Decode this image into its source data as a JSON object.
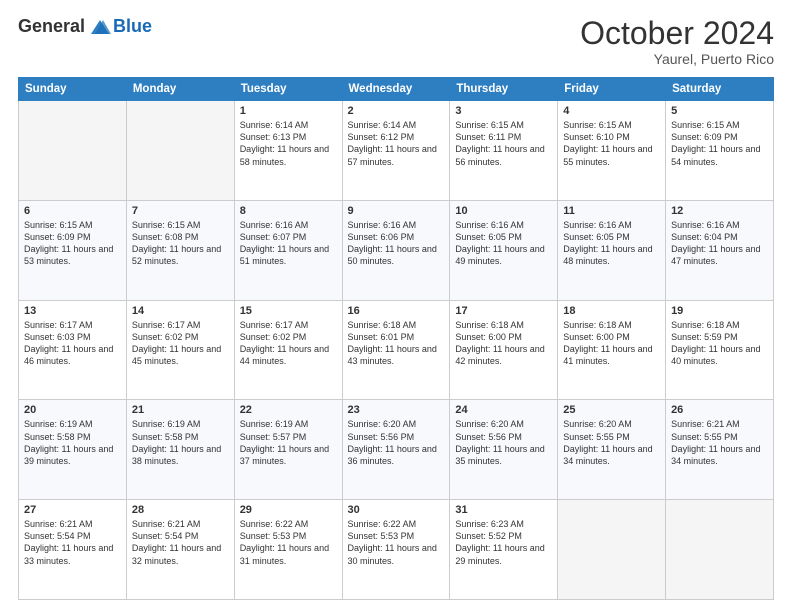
{
  "header": {
    "logo_general": "General",
    "logo_blue": "Blue",
    "month_title": "October 2024",
    "subtitle": "Yaurel, Puerto Rico"
  },
  "days_of_week": [
    "Sunday",
    "Monday",
    "Tuesday",
    "Wednesday",
    "Thursday",
    "Friday",
    "Saturday"
  ],
  "weeks": [
    [
      {
        "day": "",
        "sunrise": "",
        "sunset": "",
        "daylight": ""
      },
      {
        "day": "",
        "sunrise": "",
        "sunset": "",
        "daylight": ""
      },
      {
        "day": "1",
        "sunrise": "Sunrise: 6:14 AM",
        "sunset": "Sunset: 6:13 PM",
        "daylight": "Daylight: 11 hours and 58 minutes."
      },
      {
        "day": "2",
        "sunrise": "Sunrise: 6:14 AM",
        "sunset": "Sunset: 6:12 PM",
        "daylight": "Daylight: 11 hours and 57 minutes."
      },
      {
        "day": "3",
        "sunrise": "Sunrise: 6:15 AM",
        "sunset": "Sunset: 6:11 PM",
        "daylight": "Daylight: 11 hours and 56 minutes."
      },
      {
        "day": "4",
        "sunrise": "Sunrise: 6:15 AM",
        "sunset": "Sunset: 6:10 PM",
        "daylight": "Daylight: 11 hours and 55 minutes."
      },
      {
        "day": "5",
        "sunrise": "Sunrise: 6:15 AM",
        "sunset": "Sunset: 6:09 PM",
        "daylight": "Daylight: 11 hours and 54 minutes."
      }
    ],
    [
      {
        "day": "6",
        "sunrise": "Sunrise: 6:15 AM",
        "sunset": "Sunset: 6:09 PM",
        "daylight": "Daylight: 11 hours and 53 minutes."
      },
      {
        "day": "7",
        "sunrise": "Sunrise: 6:15 AM",
        "sunset": "Sunset: 6:08 PM",
        "daylight": "Daylight: 11 hours and 52 minutes."
      },
      {
        "day": "8",
        "sunrise": "Sunrise: 6:16 AM",
        "sunset": "Sunset: 6:07 PM",
        "daylight": "Daylight: 11 hours and 51 minutes."
      },
      {
        "day": "9",
        "sunrise": "Sunrise: 6:16 AM",
        "sunset": "Sunset: 6:06 PM",
        "daylight": "Daylight: 11 hours and 50 minutes."
      },
      {
        "day": "10",
        "sunrise": "Sunrise: 6:16 AM",
        "sunset": "Sunset: 6:05 PM",
        "daylight": "Daylight: 11 hours and 49 minutes."
      },
      {
        "day": "11",
        "sunrise": "Sunrise: 6:16 AM",
        "sunset": "Sunset: 6:05 PM",
        "daylight": "Daylight: 11 hours and 48 minutes."
      },
      {
        "day": "12",
        "sunrise": "Sunrise: 6:16 AM",
        "sunset": "Sunset: 6:04 PM",
        "daylight": "Daylight: 11 hours and 47 minutes."
      }
    ],
    [
      {
        "day": "13",
        "sunrise": "Sunrise: 6:17 AM",
        "sunset": "Sunset: 6:03 PM",
        "daylight": "Daylight: 11 hours and 46 minutes."
      },
      {
        "day": "14",
        "sunrise": "Sunrise: 6:17 AM",
        "sunset": "Sunset: 6:02 PM",
        "daylight": "Daylight: 11 hours and 45 minutes."
      },
      {
        "day": "15",
        "sunrise": "Sunrise: 6:17 AM",
        "sunset": "Sunset: 6:02 PM",
        "daylight": "Daylight: 11 hours and 44 minutes."
      },
      {
        "day": "16",
        "sunrise": "Sunrise: 6:18 AM",
        "sunset": "Sunset: 6:01 PM",
        "daylight": "Daylight: 11 hours and 43 minutes."
      },
      {
        "day": "17",
        "sunrise": "Sunrise: 6:18 AM",
        "sunset": "Sunset: 6:00 PM",
        "daylight": "Daylight: 11 hours and 42 minutes."
      },
      {
        "day": "18",
        "sunrise": "Sunrise: 6:18 AM",
        "sunset": "Sunset: 6:00 PM",
        "daylight": "Daylight: 11 hours and 41 minutes."
      },
      {
        "day": "19",
        "sunrise": "Sunrise: 6:18 AM",
        "sunset": "Sunset: 5:59 PM",
        "daylight": "Daylight: 11 hours and 40 minutes."
      }
    ],
    [
      {
        "day": "20",
        "sunrise": "Sunrise: 6:19 AM",
        "sunset": "Sunset: 5:58 PM",
        "daylight": "Daylight: 11 hours and 39 minutes."
      },
      {
        "day": "21",
        "sunrise": "Sunrise: 6:19 AM",
        "sunset": "Sunset: 5:58 PM",
        "daylight": "Daylight: 11 hours and 38 minutes."
      },
      {
        "day": "22",
        "sunrise": "Sunrise: 6:19 AM",
        "sunset": "Sunset: 5:57 PM",
        "daylight": "Daylight: 11 hours and 37 minutes."
      },
      {
        "day": "23",
        "sunrise": "Sunrise: 6:20 AM",
        "sunset": "Sunset: 5:56 PM",
        "daylight": "Daylight: 11 hours and 36 minutes."
      },
      {
        "day": "24",
        "sunrise": "Sunrise: 6:20 AM",
        "sunset": "Sunset: 5:56 PM",
        "daylight": "Daylight: 11 hours and 35 minutes."
      },
      {
        "day": "25",
        "sunrise": "Sunrise: 6:20 AM",
        "sunset": "Sunset: 5:55 PM",
        "daylight": "Daylight: 11 hours and 34 minutes."
      },
      {
        "day": "26",
        "sunrise": "Sunrise: 6:21 AM",
        "sunset": "Sunset: 5:55 PM",
        "daylight": "Daylight: 11 hours and 34 minutes."
      }
    ],
    [
      {
        "day": "27",
        "sunrise": "Sunrise: 6:21 AM",
        "sunset": "Sunset: 5:54 PM",
        "daylight": "Daylight: 11 hours and 33 minutes."
      },
      {
        "day": "28",
        "sunrise": "Sunrise: 6:21 AM",
        "sunset": "Sunset: 5:54 PM",
        "daylight": "Daylight: 11 hours and 32 minutes."
      },
      {
        "day": "29",
        "sunrise": "Sunrise: 6:22 AM",
        "sunset": "Sunset: 5:53 PM",
        "daylight": "Daylight: 11 hours and 31 minutes."
      },
      {
        "day": "30",
        "sunrise": "Sunrise: 6:22 AM",
        "sunset": "Sunset: 5:53 PM",
        "daylight": "Daylight: 11 hours and 30 minutes."
      },
      {
        "day": "31",
        "sunrise": "Sunrise: 6:23 AM",
        "sunset": "Sunset: 5:52 PM",
        "daylight": "Daylight: 11 hours and 29 minutes."
      },
      {
        "day": "",
        "sunrise": "",
        "sunset": "",
        "daylight": ""
      },
      {
        "day": "",
        "sunrise": "",
        "sunset": "",
        "daylight": ""
      }
    ]
  ]
}
